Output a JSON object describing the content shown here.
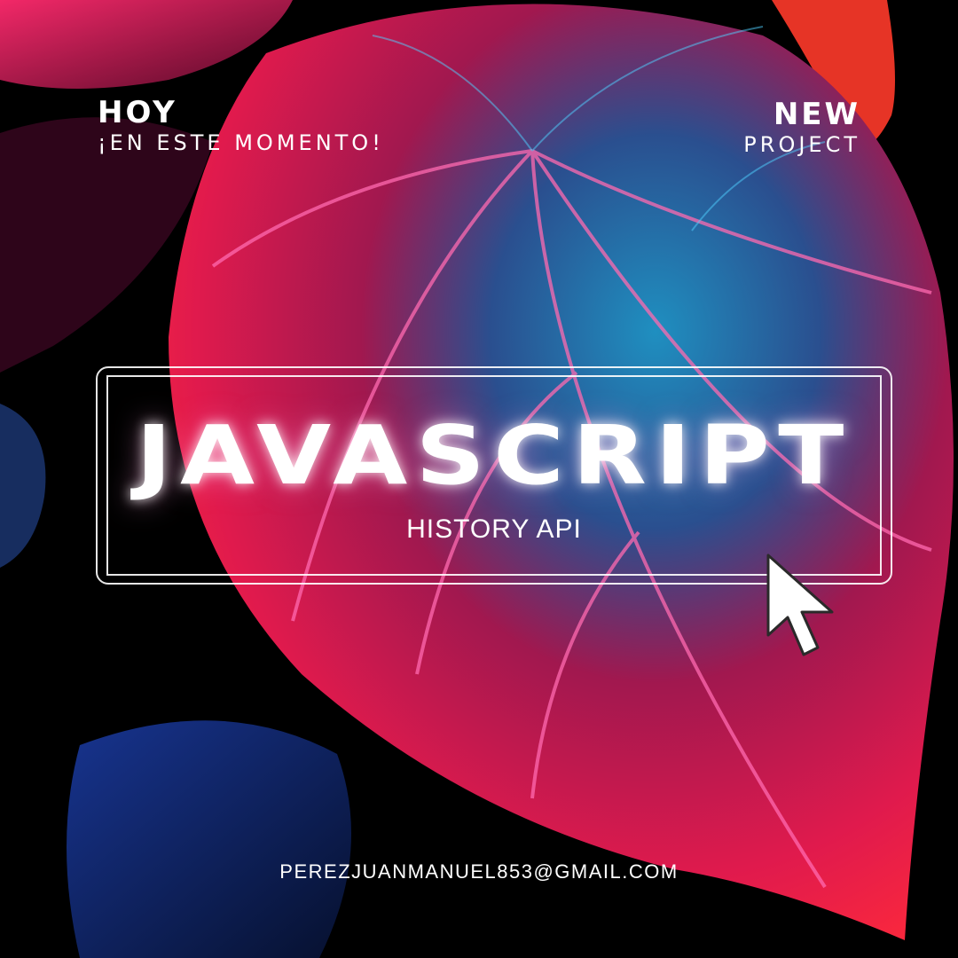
{
  "top_left": {
    "heading": "HOY",
    "subheading": "¡EN ESTE MOMENTO!"
  },
  "top_right": {
    "heading": "NEW",
    "subheading": "PROJECT"
  },
  "main": {
    "title": "JAVASCRIPT",
    "subtitle": "HISTORY API"
  },
  "footer": {
    "email": "PEREZJUANMANUEL853@GMAIL.COM"
  },
  "icons": {
    "cursor": "mouse-pointer-icon"
  },
  "colors": {
    "background": "#000000",
    "leaf_magenta": "#ff1f6b",
    "leaf_cyan": "#1fa8d8",
    "text": "#ffffff"
  }
}
